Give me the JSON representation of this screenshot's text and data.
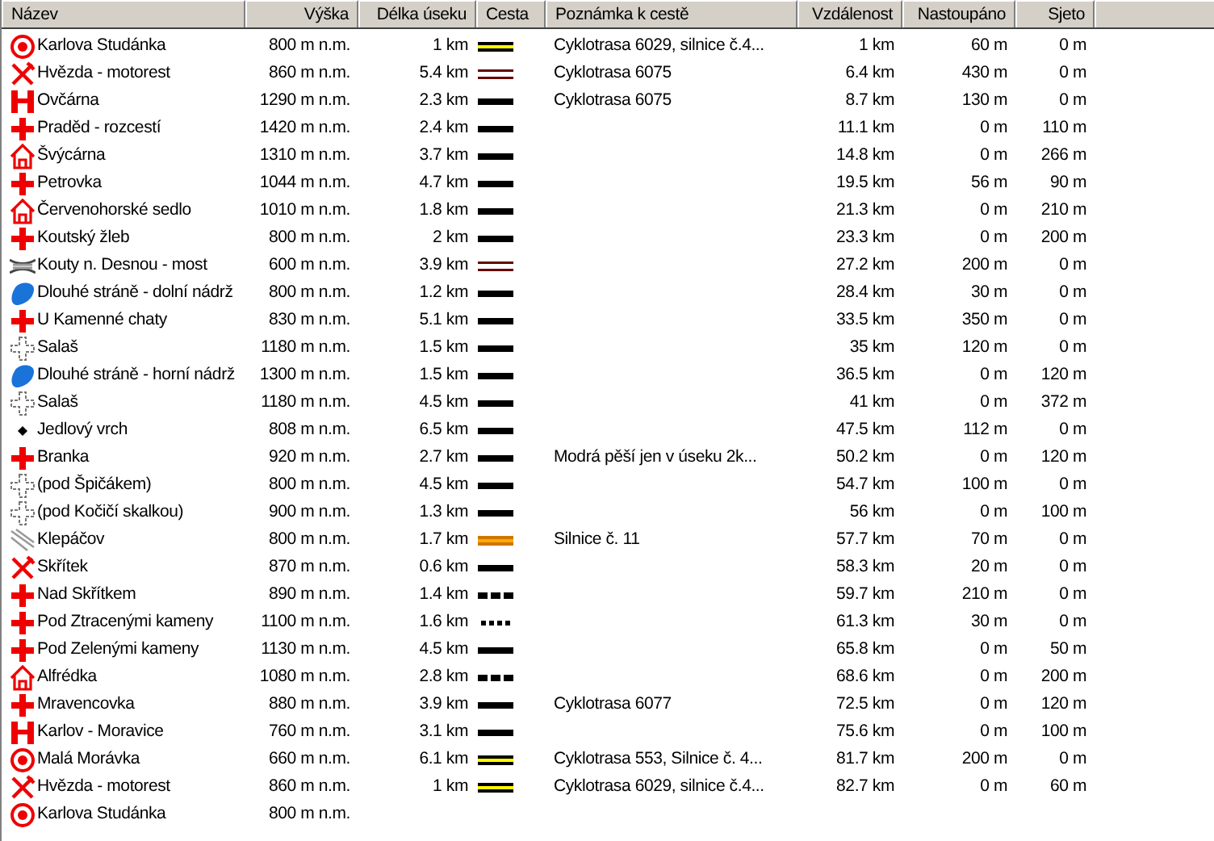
{
  "columns": [
    "Název",
    "Výška",
    "Délka úseku",
    "Cesta",
    "Poznámka k cestě",
    "Vzdálenost",
    "Nastoupáno",
    "Sjeto"
  ],
  "rows": [
    {
      "kind": "target",
      "name": "Karlova Studánka",
      "altitude": "800 m n.m.",
      "length": "1 km",
      "trail": {
        "kind": "yellow"
      },
      "note": "Cyklotrasa 6029, silnice č.4...",
      "distance": "1 km",
      "ascent": "60 m",
      "descent": "0 m"
    },
    {
      "kind": "food",
      "name": "Hvězda - motorest",
      "altitude": "860 m n.m.",
      "length": "5.4 km",
      "trail": {
        "kind": "brown"
      },
      "note": "Cyklotrasa 6075",
      "distance": "6.4 km",
      "ascent": "430 m",
      "descent": "0 m"
    },
    {
      "kind": "hotel",
      "name": "Ovčárna",
      "altitude": "1290 m n.m.",
      "length": "2.3 km",
      "trail": {
        "kind": "solid"
      },
      "note": "Cyklotrasa 6075",
      "distance": "8.7 km",
      "ascent": "130 m",
      "descent": "0 m"
    },
    {
      "kind": "cross",
      "name": "Praděd - rozcestí",
      "altitude": "1420 m n.m.",
      "length": "2.4 km",
      "trail": {
        "kind": "solid"
      },
      "distance": "11.1 km",
      "ascent": "0 m",
      "descent": "110 m"
    },
    {
      "kind": "house",
      "name": "Švýcárna",
      "altitude": "1310 m n.m.",
      "length": "3.7 km",
      "trail": {
        "kind": "solid"
      },
      "distance": "14.8 km",
      "ascent": "0 m",
      "descent": "266 m"
    },
    {
      "kind": "cross",
      "name": "Petrovka",
      "altitude": "1044 m n.m.",
      "length": "4.7 km",
      "trail": {
        "kind": "solid"
      },
      "distance": "19.5 km",
      "ascent": "56 m",
      "descent": "90 m"
    },
    {
      "kind": "house",
      "name": "Červenohorské sedlo",
      "altitude": "1010 m n.m.",
      "length": "1.8 km",
      "trail": {
        "kind": "solid"
      },
      "distance": "21.3 km",
      "ascent": "0 m",
      "descent": "210 m"
    },
    {
      "kind": "cross",
      "name": "Koutský žleb",
      "altitude": "800 m n.m.",
      "length": "2 km",
      "trail": {
        "kind": "solid"
      },
      "distance": "23.3 km",
      "ascent": "0 m",
      "descent": "200 m"
    },
    {
      "kind": "bridge",
      "name": "Kouty n. Desnou - most",
      "altitude": "600 m n.m.",
      "length": "3.9 km",
      "trail": {
        "kind": "brown"
      },
      "distance": "27.2 km",
      "ascent": "200 m",
      "descent": "0 m"
    },
    {
      "kind": "water",
      "name": "Dlouhé stráně - dolní nádrž",
      "altitude": "800 m n.m.",
      "length": "1.2 km",
      "trail": {
        "kind": "solid"
      },
      "distance": "28.4 km",
      "ascent": "30 m",
      "descent": "0 m"
    },
    {
      "kind": "cross",
      "name": "U Kamenné chaty",
      "altitude": "830 m n.m.",
      "length": "5.1 km",
      "trail": {
        "kind": "solid"
      },
      "distance": "33.5 km",
      "ascent": "350 m",
      "descent": "0 m"
    },
    {
      "kind": "junction",
      "name": "Salaš",
      "altitude": "1180 m n.m.",
      "length": "1.5 km",
      "trail": {
        "kind": "solid"
      },
      "distance": "35 km",
      "ascent": "120 m",
      "descent": "0 m"
    },
    {
      "kind": "water",
      "name": "Dlouhé stráně - horní nádrž",
      "altitude": "1300 m n.m.",
      "length": "1.5 km",
      "trail": {
        "kind": "solid"
      },
      "distance": "36.5 km",
      "ascent": "0 m",
      "descent": "120 m"
    },
    {
      "kind": "junction",
      "name": "Salaš",
      "altitude": "1180 m n.m.",
      "length": "4.5 km",
      "trail": {
        "kind": "solid"
      },
      "distance": "41 km",
      "ascent": "0 m",
      "descent": "372 m"
    },
    {
      "kind": "dot",
      "name": "Jedlový vrch",
      "altitude": "808 m n.m.",
      "length": "6.5 km",
      "trail": {
        "kind": "solid"
      },
      "distance": "47.5 km",
      "ascent": "112 m",
      "descent": "0 m"
    },
    {
      "kind": "cross",
      "name": "Branka",
      "altitude": "920 m n.m.",
      "length": "2.7 km",
      "trail": {
        "kind": "solid"
      },
      "note": "Modrá pěší jen v úseku 2k...",
      "distance": "50.2 km",
      "ascent": "0 m",
      "descent": "120 m"
    },
    {
      "kind": "junction",
      "name": "(pod Špičákem)",
      "altitude": "800 m n.m.",
      "length": "4.5 km",
      "trail": {
        "kind": "solid"
      },
      "distance": "54.7 km",
      "ascent": "100 m",
      "descent": "0 m"
    },
    {
      "kind": "junction",
      "name": "(pod Kočičí skalkou)",
      "altitude": "900 m n.m.",
      "length": "1.3 km",
      "trail": {
        "kind": "solid"
      },
      "distance": "56 km",
      "ascent": "0 m",
      "descent": "100 m"
    },
    {
      "kind": "road",
      "name": "Klepáčov",
      "altitude": "800 m n.m.",
      "length": "1.7 km",
      "trail": {
        "kind": "orange"
      },
      "note": "Silnice č. 11",
      "distance": "57.7 km",
      "ascent": "70 m",
      "descent": "0 m"
    },
    {
      "kind": "food",
      "name": "Skřítek",
      "altitude": "870 m n.m.",
      "length": "0.6 km",
      "trail": {
        "kind": "solid"
      },
      "distance": "58.3 km",
      "ascent": "20 m",
      "descent": "0 m"
    },
    {
      "kind": "cross",
      "name": "Nad Skřítkem",
      "altitude": "890 m n.m.",
      "length": "1.4 km",
      "trail": {
        "kind": "dashed"
      },
      "distance": "59.7 km",
      "ascent": "210 m",
      "descent": "0 m"
    },
    {
      "kind": "cross",
      "name": "Pod Ztracenými kameny",
      "altitude": "1100 m n.m.",
      "length": "1.6 km",
      "trail": {
        "kind": "dotted"
      },
      "distance": "61.3 km",
      "ascent": "30 m",
      "descent": "0 m"
    },
    {
      "kind": "cross",
      "name": "Pod Zelenými kameny",
      "altitude": "1130 m n.m.",
      "length": "4.5 km",
      "trail": {
        "kind": "solid"
      },
      "distance": "65.8 km",
      "ascent": "0 m",
      "descent": "50 m"
    },
    {
      "kind": "house",
      "name": "Alfrédka",
      "altitude": "1080 m n.m.",
      "length": "2.8 km",
      "trail": {
        "kind": "dashed"
      },
      "distance": "68.6 km",
      "ascent": "0 m",
      "descent": "200 m"
    },
    {
      "kind": "cross",
      "name": "Mravencovka",
      "altitude": "880 m n.m.",
      "length": "3.9 km",
      "trail": {
        "kind": "solid"
      },
      "note": "Cyklotrasa 6077",
      "distance": "72.5 km",
      "ascent": "0 m",
      "descent": "120 m"
    },
    {
      "kind": "hotel",
      "name": "Karlov - Moravice",
      "altitude": "760 m n.m.",
      "length": "3.1 km",
      "trail": {
        "kind": "solid"
      },
      "distance": "75.6 km",
      "ascent": "0 m",
      "descent": "100 m"
    },
    {
      "kind": "target",
      "name": "Malá Morávka",
      "altitude": "660 m n.m.",
      "length": "6.1 km",
      "trail": {
        "kind": "yellow"
      },
      "note": "Cyklotrasa 553, Silnice č. 4...",
      "distance": "81.7 km",
      "ascent": "200 m",
      "descent": "0 m"
    },
    {
      "kind": "food",
      "name": "Hvězda - motorest",
      "altitude": "860 m n.m.",
      "length": "1 km",
      "trail": {
        "kind": "yellow"
      },
      "note": "Cyklotrasa 6029, silnice č.4...",
      "distance": "82.7 km",
      "ascent": "0 m",
      "descent": "60 m"
    },
    {
      "kind": "target",
      "name": "Karlova Studánka",
      "altitude": "800 m n.m."
    }
  ]
}
